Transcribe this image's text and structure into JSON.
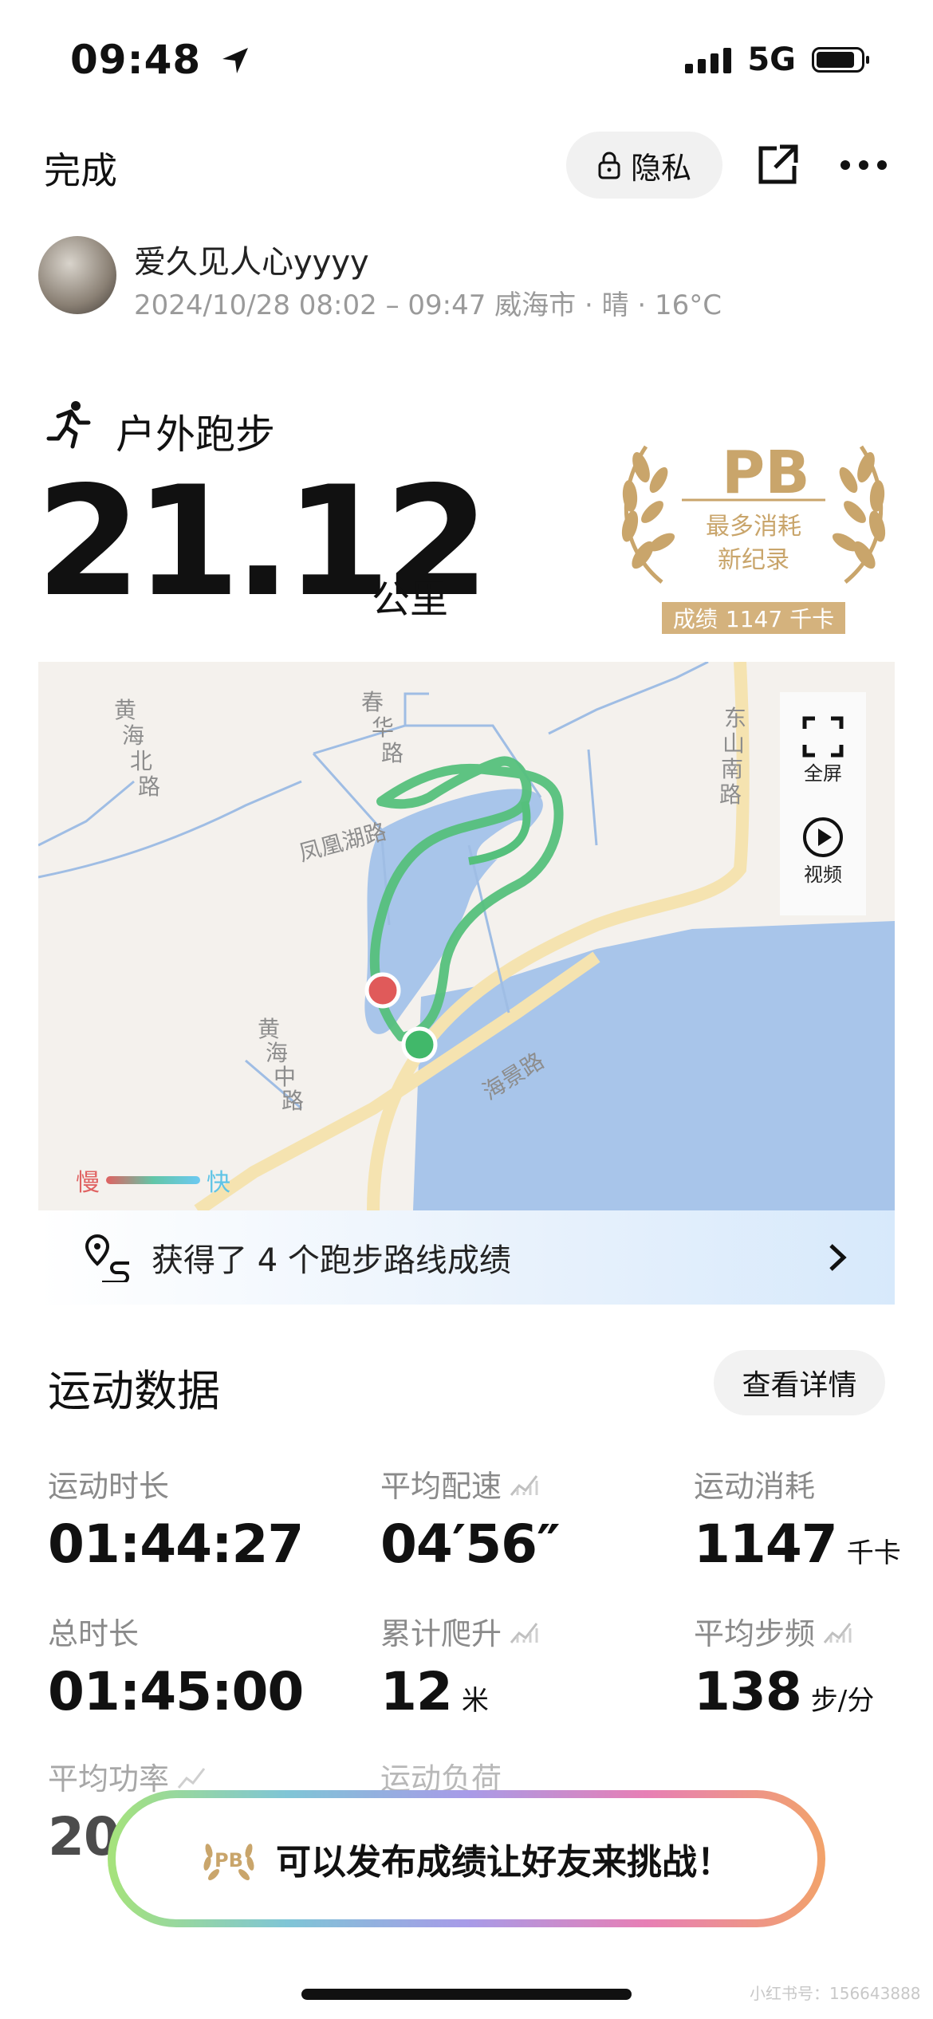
{
  "status_bar": {
    "time": "09:48",
    "network": "5G"
  },
  "nav": {
    "done_label": "完成",
    "privacy_label": "隐私"
  },
  "user": {
    "name": "爱久见人心yyyy",
    "meta": "2024/10/28 08:02 – 09:47 威海市 · 晴 · 16°C"
  },
  "activity": {
    "type": "户外跑步",
    "distance": "21.12",
    "distance_unit": "公里"
  },
  "pb_badge": {
    "title": "PB",
    "line1": "最多消耗",
    "line2": "新纪录",
    "result_label": "成绩",
    "result_value": "1147 千卡"
  },
  "map": {
    "roads": [
      "黄海北路",
      "春华路",
      "凤凰湖路",
      "黄海中路",
      "东山南路",
      "海景路"
    ],
    "fullscreen_label": "全屏",
    "video_label": "视频",
    "legend_slow": "慢",
    "legend_fast": "快",
    "colors": {
      "route": "#4cba73",
      "water": "#a8c5ea",
      "start": "#e05a5a",
      "end": "#41b86a"
    }
  },
  "route_banner": {
    "text": "获得了 4 个跑步路线成绩"
  },
  "section": {
    "title": "运动数据",
    "detail_button": "查看详情"
  },
  "stats": [
    {
      "label": "运动时长",
      "value": "01:44:27",
      "unit": ""
    },
    {
      "label": "平均配速",
      "value": "04′56″",
      "unit": ""
    },
    {
      "label": "运动消耗",
      "value": "1147",
      "unit": "千卡"
    },
    {
      "label": "总时长",
      "value": "01:45:00",
      "unit": ""
    },
    {
      "label": "累计爬升",
      "value": "12",
      "unit": "米"
    },
    {
      "label": "平均步频",
      "value": "138",
      "unit": "步/分"
    },
    {
      "label": "平均功率",
      "value": "20",
      "unit": ""
    },
    {
      "label": "运动负荷",
      "value": "",
      "unit": ""
    }
  ],
  "prompt": {
    "text": "可以发布成绩让好友来挑战！"
  },
  "watermark": "小红书号：156643888"
}
